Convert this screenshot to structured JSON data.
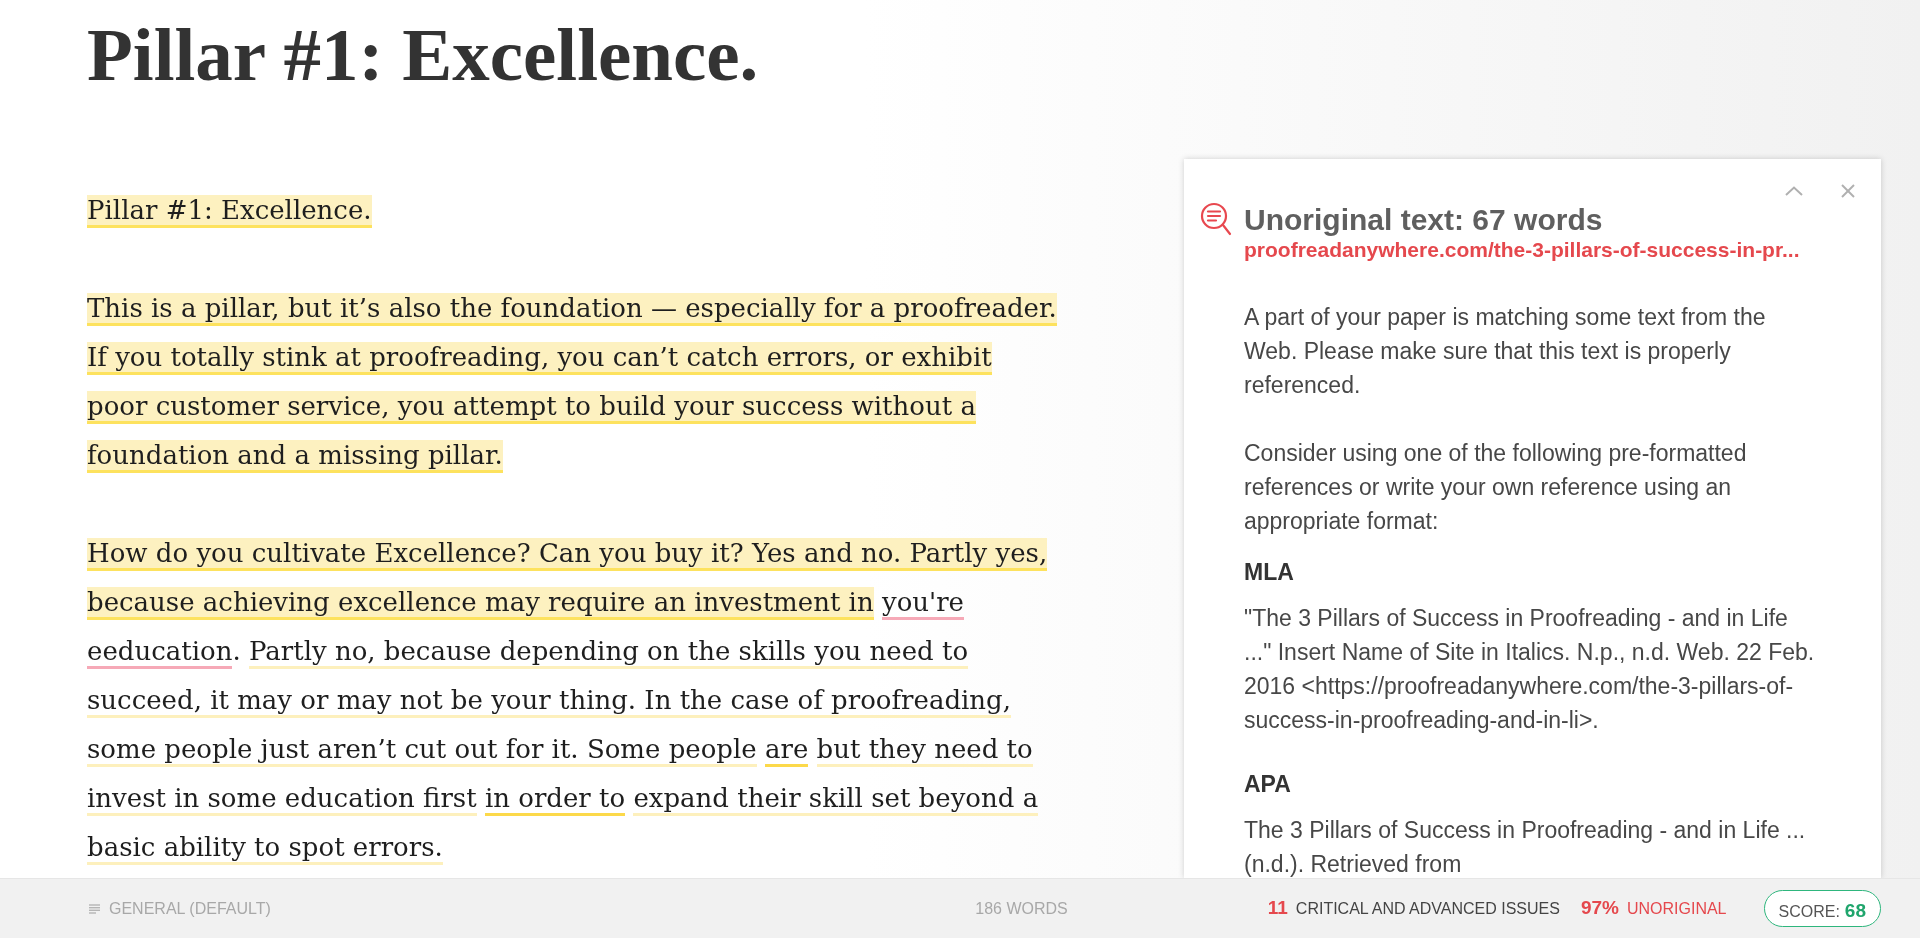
{
  "document": {
    "title": "Pillar #1: Excellence.",
    "paragraphs": [
      {
        "segments": [
          {
            "text": "Pillar #1: Excellence.",
            "kind": "unoriginal_active"
          }
        ]
      },
      {
        "segments": [
          {
            "text": "This is a pillar, but it’s also the foundation — especially for a proofreader. If you totally stink at proofreading, you can’t catch errors, or exhibit poor customer service, you attempt to build your success without a foundation and a missing pillar.",
            "kind": "unoriginal_active"
          }
        ]
      },
      {
        "segments": [
          {
            "text": "How do you cultivate Excellence? Can you buy it? Yes and no. Partly yes, because achieving excellence may require an investment in",
            "kind": "unoriginal_active"
          },
          {
            "text": " you're",
            "kind": "critical"
          },
          {
            "text": " eeducation",
            "kind": "critical"
          },
          {
            "text": ". ",
            "kind": "plain"
          },
          {
            "text": "Partly no, because depending on the skills you need to succeed, it may or may not be your thing. In the case of proofreading, some people just aren’t cut out for it. Some people ",
            "kind": "unoriginal"
          },
          {
            "text": "are",
            "kind": "advanced"
          },
          {
            "text": " but they need to invest in some education first ",
            "kind": "unoriginal"
          },
          {
            "text": "in order to",
            "kind": "advanced"
          },
          {
            "text": " expand their skill set beyond a basic ability to spot errors.",
            "kind": "unoriginal"
          }
        ]
      }
    ]
  },
  "card": {
    "title": "Unoriginal text: 67 words",
    "source": "proofreadanywhere.com/the-3-pillars-of-success-in-pr...",
    "paragraphs": [
      "A part of your paper is matching some text from the Web. Please make sure that this text is properly referenced.",
      "Consider using one of the following pre-formatted references or write your own reference using an appropriate format:"
    ],
    "citations": [
      {
        "style": "MLA",
        "text": "\"The 3 Pillars of Success in Proofreading - and in Life ...\" Insert Name of Site in Italics. N.p., n.d. Web. 22 Feb. 2016 <https://proofreadanywhere.com/the-3-pillars-of-success-in-proofreading-and-in-li>."
      },
      {
        "style": "APA",
        "text": "The 3 Pillars of Success in Proofreading - and in Life ... (n.d.). Retrieved from"
      }
    ]
  },
  "status_bar": {
    "goal": "GENERAL (DEFAULT)",
    "word_count": "186 WORDS",
    "issues": {
      "count": "11",
      "label": "CRITICAL AND ADVANCED ISSUES"
    },
    "unoriginal": {
      "percent": "97%",
      "label": "UNORIGINAL"
    },
    "score": {
      "label": "SCORE:",
      "value": "68"
    }
  }
}
